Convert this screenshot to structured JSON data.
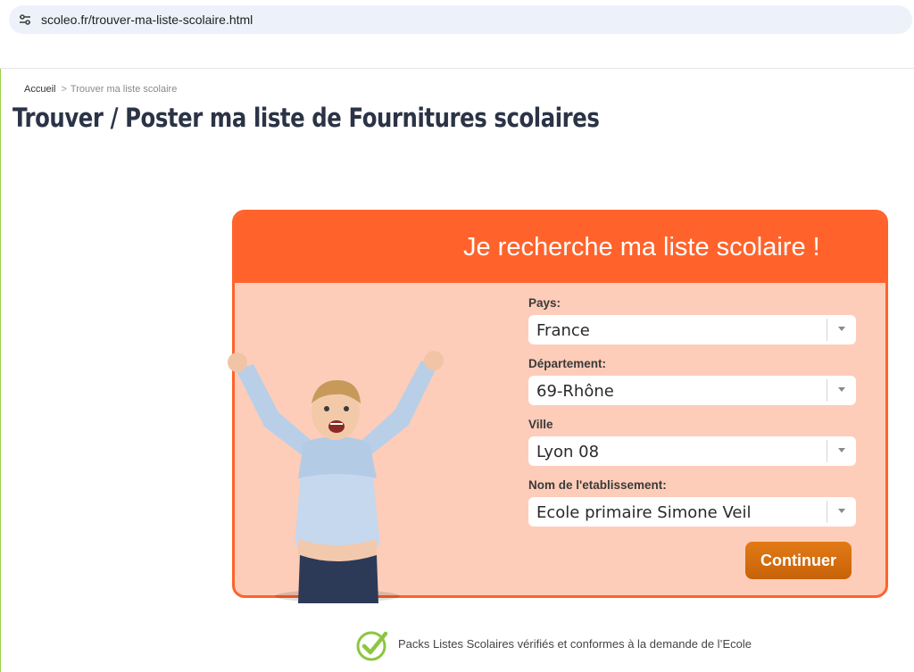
{
  "browser": {
    "url": "scoleo.fr/trouver-ma-liste-scolaire.html",
    "site_icon": "site-info-icon"
  },
  "breadcrumb": {
    "home": "Accueil",
    "separator": ">",
    "current": "Trouver ma liste scolaire"
  },
  "page": {
    "title": "Trouver / Poster ma liste de Fournitures scolaires"
  },
  "search_card": {
    "title": "Je recherche ma liste scolaire !",
    "fields": [
      {
        "label": "Pays:",
        "value": "France"
      },
      {
        "label": "Département:",
        "value": "69-Rhône"
      },
      {
        "label": "Ville",
        "value": "Lyon 08"
      },
      {
        "label": "Nom de l'etablissement:",
        "value": "Ecole primaire Simone Veil"
      }
    ],
    "continue_label": "Continuer"
  },
  "footer": {
    "reassurance_text": "Packs Listes Scolaires vérifiés et conformes à la demande de l’Ecole",
    "icon": "check-circle-icon"
  },
  "colors": {
    "accent": "#ff632b",
    "card_background": "#fdcdb9",
    "button": "#d56c0e",
    "title": "#2b3346",
    "check": "#8cc63f"
  }
}
